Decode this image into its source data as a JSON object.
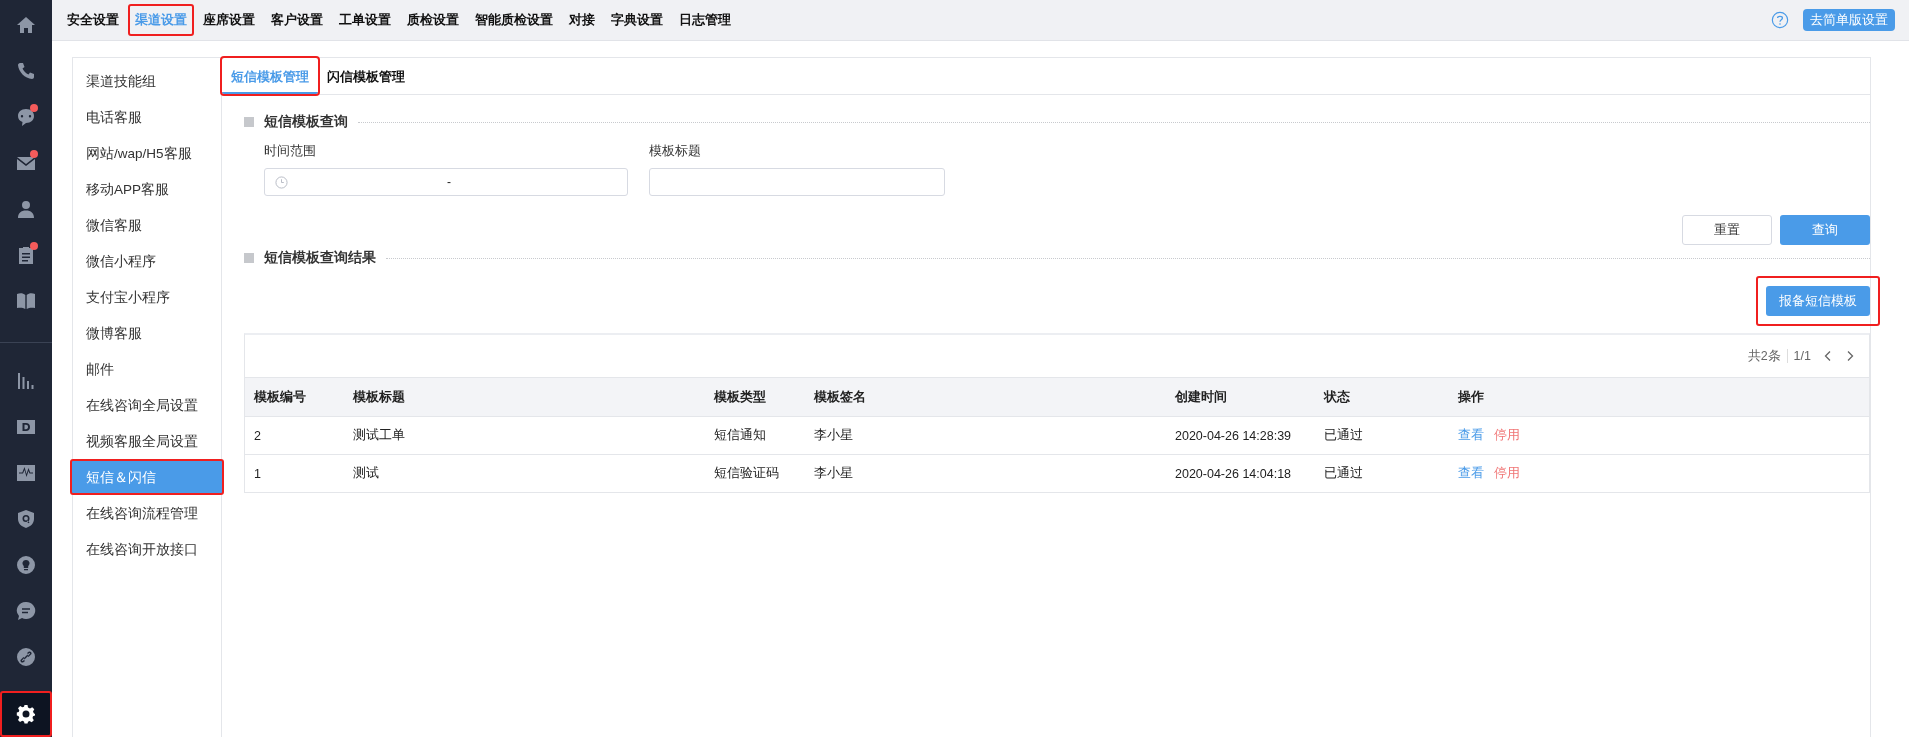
{
  "rail": {
    "groups": [
      [
        {
          "kind": "home",
          "badge": false,
          "selected": false,
          "highlighted": false
        },
        {
          "kind": "phone",
          "badge": false,
          "selected": false,
          "highlighted": false
        },
        {
          "kind": "chat",
          "badge": true,
          "selected": false,
          "highlighted": false
        },
        {
          "kind": "mail",
          "badge": true,
          "selected": false,
          "highlighted": false
        },
        {
          "kind": "person",
          "badge": false,
          "selected": false,
          "highlighted": false
        },
        {
          "kind": "clipboard",
          "badge": true,
          "selected": false,
          "highlighted": false
        },
        {
          "kind": "book",
          "badge": false,
          "selected": false,
          "highlighted": false
        }
      ],
      [
        {
          "kind": "bars",
          "badge": false,
          "selected": false,
          "highlighted": false
        },
        {
          "kind": "dletter",
          "badge": false,
          "selected": false,
          "highlighted": false
        },
        {
          "kind": "pulse",
          "badge": false,
          "selected": false,
          "highlighted": false
        },
        {
          "kind": "shield",
          "badge": false,
          "selected": false,
          "highlighted": false
        },
        {
          "kind": "bulb",
          "badge": false,
          "selected": false,
          "highlighted": false
        },
        {
          "kind": "message",
          "badge": false,
          "selected": false,
          "highlighted": false
        },
        {
          "kind": "link",
          "badge": false,
          "selected": false,
          "highlighted": false
        },
        {
          "kind": "gear",
          "badge": false,
          "selected": true,
          "highlighted": true
        }
      ]
    ]
  },
  "top_nav": {
    "items": [
      {
        "label": "安全设置",
        "selected": false,
        "highlighted": false
      },
      {
        "label": "渠道设置",
        "selected": true,
        "highlighted": true
      },
      {
        "label": "座席设置",
        "selected": false,
        "highlighted": false
      },
      {
        "label": "客户设置",
        "selected": false,
        "highlighted": false
      },
      {
        "label": "工单设置",
        "selected": false,
        "highlighted": false
      },
      {
        "label": "质检设置",
        "selected": false,
        "highlighted": false
      },
      {
        "label": "智能质检设置",
        "selected": false,
        "highlighted": false
      },
      {
        "label": "对接",
        "selected": false,
        "highlighted": false
      },
      {
        "label": "字典设置",
        "selected": false,
        "highlighted": false
      },
      {
        "label": "日志管理",
        "selected": false,
        "highlighted": false
      }
    ],
    "simple_button": "去简单版设置"
  },
  "sidebar": {
    "items": [
      {
        "label": "渠道技能组",
        "selected": false,
        "highlighted": false
      },
      {
        "label": "电话客服",
        "selected": false,
        "highlighted": false
      },
      {
        "label": "网站/wap/H5客服",
        "selected": false,
        "highlighted": false
      },
      {
        "label": "移动APP客服",
        "selected": false,
        "highlighted": false
      },
      {
        "label": "微信客服",
        "selected": false,
        "highlighted": false
      },
      {
        "label": "微信小程序",
        "selected": false,
        "highlighted": false
      },
      {
        "label": "支付宝小程序",
        "selected": false,
        "highlighted": false
      },
      {
        "label": "微博客服",
        "selected": false,
        "highlighted": false
      },
      {
        "label": "邮件",
        "selected": false,
        "highlighted": false
      },
      {
        "label": "在线咨询全局设置",
        "selected": false,
        "highlighted": false
      },
      {
        "label": "视频客服全局设置",
        "selected": false,
        "highlighted": false
      },
      {
        "label": "短信＆闪信",
        "selected": true,
        "highlighted": true
      },
      {
        "label": "在线咨询流程管理",
        "selected": false,
        "highlighted": false
      },
      {
        "label": "在线咨询开放接口",
        "selected": false,
        "highlighted": false
      }
    ]
  },
  "tabs": [
    {
      "label": "短信模板管理",
      "selected": true,
      "highlighted": true
    },
    {
      "label": "闪信模板管理",
      "selected": false,
      "highlighted": false
    }
  ],
  "query": {
    "title": "短信模板查询",
    "time_range": {
      "label": "时间范围",
      "separator": "-"
    },
    "template_title": {
      "label": "模板标题"
    },
    "buttons": [
      {
        "label": "重置",
        "kind": "plain"
      },
      {
        "label": "查询",
        "kind": "primary"
      }
    ]
  },
  "results": {
    "title": "短信模板查询结果",
    "report_button": {
      "label": "报备短信模板",
      "highlighted": true
    },
    "pagination": {
      "total": "共2条",
      "page": "1/1"
    },
    "table": {
      "columns": [
        "模板编号",
        "模板标题",
        "模板类型",
        "模板签名",
        "创建时间",
        "状态",
        "操作"
      ],
      "rows": [
        {
          "cells": [
            "2",
            "测试工单",
            "短信通知",
            "李小星",
            "2020-04-26 14:28:39",
            "已通过"
          ],
          "actions": [
            "查看",
            "停用"
          ]
        },
        {
          "cells": [
            "1",
            "测试",
            "短信验证码",
            "李小星",
            "2020-04-26 14:04:18",
            "已通过"
          ],
          "actions": [
            "查看",
            "停用"
          ]
        }
      ]
    }
  }
}
